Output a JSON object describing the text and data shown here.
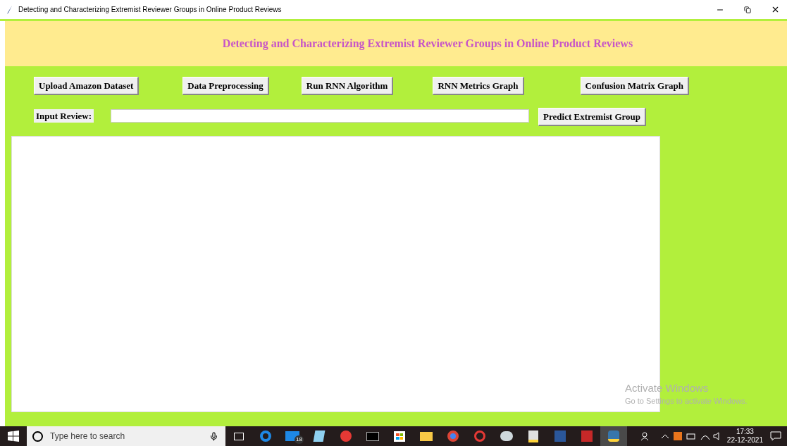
{
  "window": {
    "title": "Detecting and Characterizing Extremist Reviewer Groups in Online Product Reviews"
  },
  "header": {
    "title": "Detecting and Characterizing Extremist Reviewer Groups in Online Product Reviews"
  },
  "buttons": [
    "Upload Amazon Dataset",
    "Data Preprocessing",
    "Run RNN Algorithm",
    "RNN Metrics Graph",
    "Confusion Matrix Graph"
  ],
  "input_row": {
    "label": "Input Review:",
    "button": "Predict Extremist Group"
  },
  "activation": {
    "title": "Activate Windows",
    "subtitle": "Go to Settings to activate Windows."
  },
  "taskbar": {
    "search_placeholder": "Type here to search",
    "mail_badge": "18",
    "time": "17:33",
    "date": "22-12-2021"
  }
}
